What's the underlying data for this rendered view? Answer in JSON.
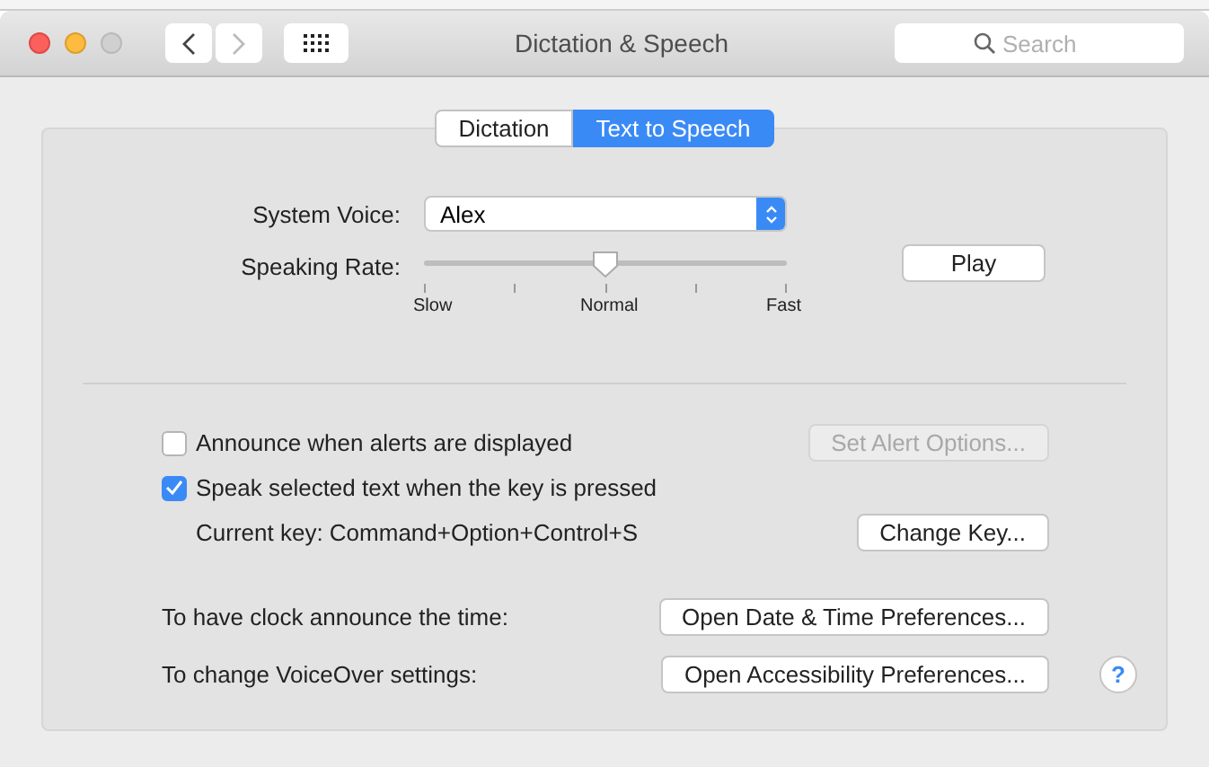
{
  "window": {
    "title": "Dictation & Speech",
    "search": {
      "placeholder": "Search"
    }
  },
  "tabs": [
    {
      "label": "Dictation",
      "selected": false
    },
    {
      "label": "Text to Speech",
      "selected": true
    }
  ],
  "system_voice": {
    "label": "System Voice:",
    "value": "Alex"
  },
  "speaking_rate": {
    "label": "Speaking Rate:",
    "level": 0.5,
    "marks": [
      "Slow",
      "Normal",
      "Fast"
    ]
  },
  "play_button": "Play",
  "options": [
    {
      "label": "Announce when alerts are displayed",
      "checked": false,
      "button": {
        "label": "Set Alert Options...",
        "disabled": true
      }
    },
    {
      "label": "Speak selected text when the key is pressed",
      "checked": true
    }
  ],
  "current_key": {
    "text": "Current key: Command+Option+Control+S",
    "button": {
      "label": "Change Key...",
      "disabled": false
    }
  },
  "links": [
    {
      "label": "To have clock announce the time:",
      "button": "Open Date & Time Preferences..."
    },
    {
      "label": "To change VoiceOver settings:",
      "button": "Open Accessibility Preferences..."
    }
  ],
  "help_button": "?"
}
